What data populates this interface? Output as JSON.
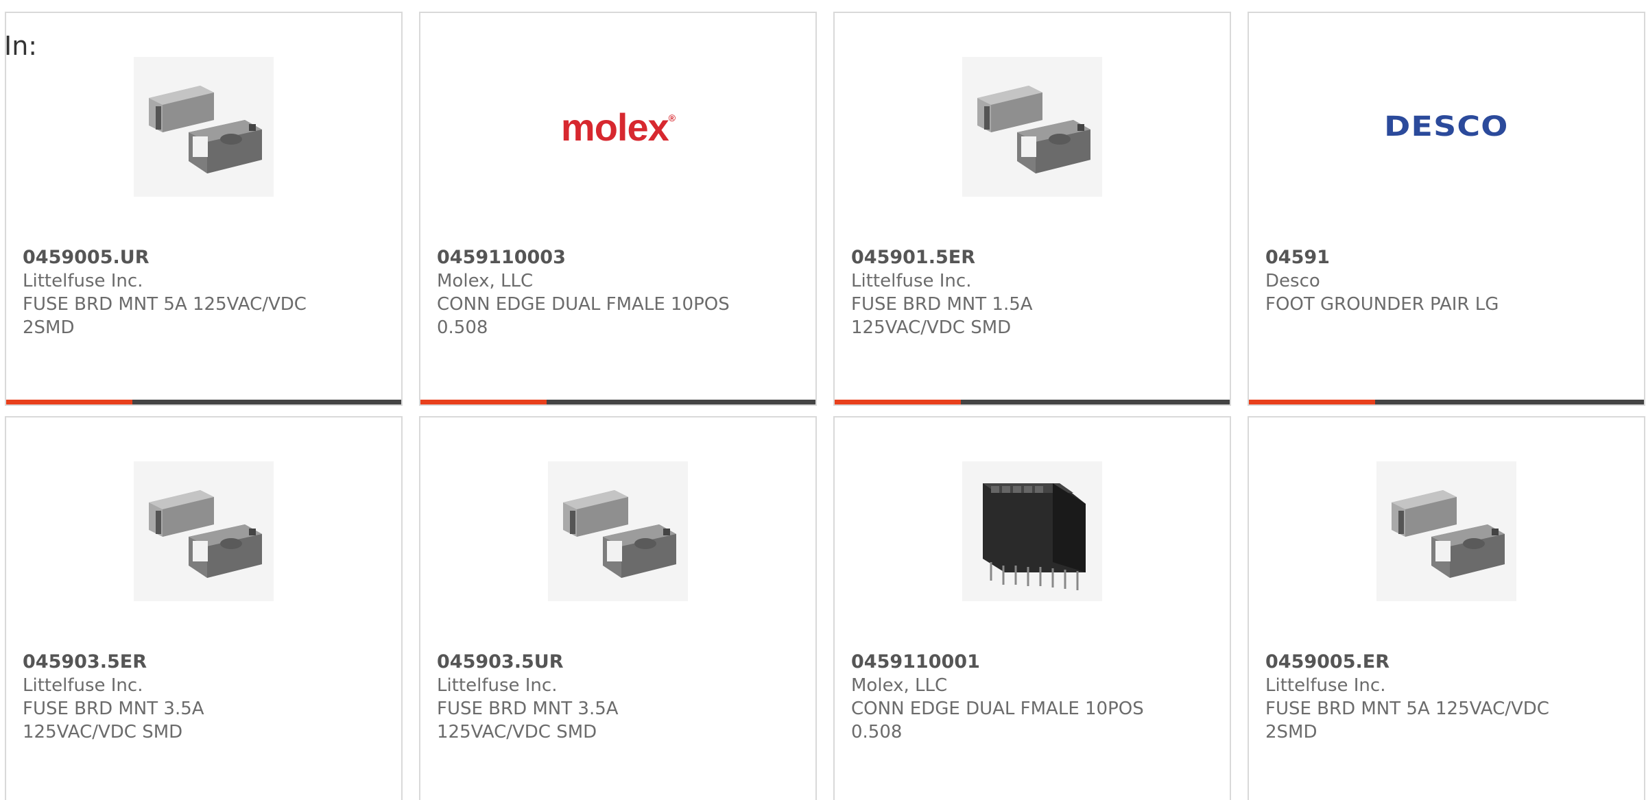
{
  "header": {
    "in_label": "In:"
  },
  "colors": {
    "progress_fill": "#e8401c",
    "progress_track": "#444444",
    "molex_red": "#d7282f",
    "desco_blue": "#2b4a9b"
  },
  "products": [
    {
      "part_number": "0459005.UR",
      "manufacturer": "Littelfuse Inc.",
      "description": "FUSE BRD MNT 5A 125VAC/VDC 2SMD",
      "image": "smd-fuse-icon",
      "progress": 0.32
    },
    {
      "part_number": "0459110003",
      "manufacturer": "Molex, LLC",
      "description": "CONN EDGE DUAL FMALE 10POS 0.508",
      "image": "molex-logo",
      "logo_text": "molex",
      "progress": 0.32
    },
    {
      "part_number": "045901.5ER",
      "manufacturer": "Littelfuse Inc.",
      "description": "FUSE BRD MNT 1.5A 125VAC/VDC SMD",
      "image": "smd-fuse-icon",
      "progress": 0.32
    },
    {
      "part_number": "04591",
      "manufacturer": "Desco",
      "description": "FOOT GROUNDER PAIR LG",
      "image": "desco-logo",
      "logo_text": "DESCO",
      "progress": 0.32
    },
    {
      "part_number": "045903.5ER",
      "manufacturer": "Littelfuse Inc.",
      "description": "FUSE BRD MNT 3.5A 125VAC/VDC SMD",
      "image": "smd-fuse-icon",
      "progress": 0
    },
    {
      "part_number": "045903.5UR",
      "manufacturer": "Littelfuse Inc.",
      "description": "FUSE BRD MNT 3.5A 125VAC/VDC SMD",
      "image": "smd-fuse-icon",
      "progress": 0
    },
    {
      "part_number": "0459110001",
      "manufacturer": "Molex, LLC",
      "description": "CONN EDGE DUAL FMALE 10POS 0.508",
      "image": "edge-connector-icon",
      "progress": 0
    },
    {
      "part_number": "0459005.ER",
      "manufacturer": "Littelfuse Inc.",
      "description": "FUSE BRD MNT 5A 125VAC/VDC 2SMD",
      "image": "smd-fuse-icon",
      "progress": 0
    }
  ]
}
